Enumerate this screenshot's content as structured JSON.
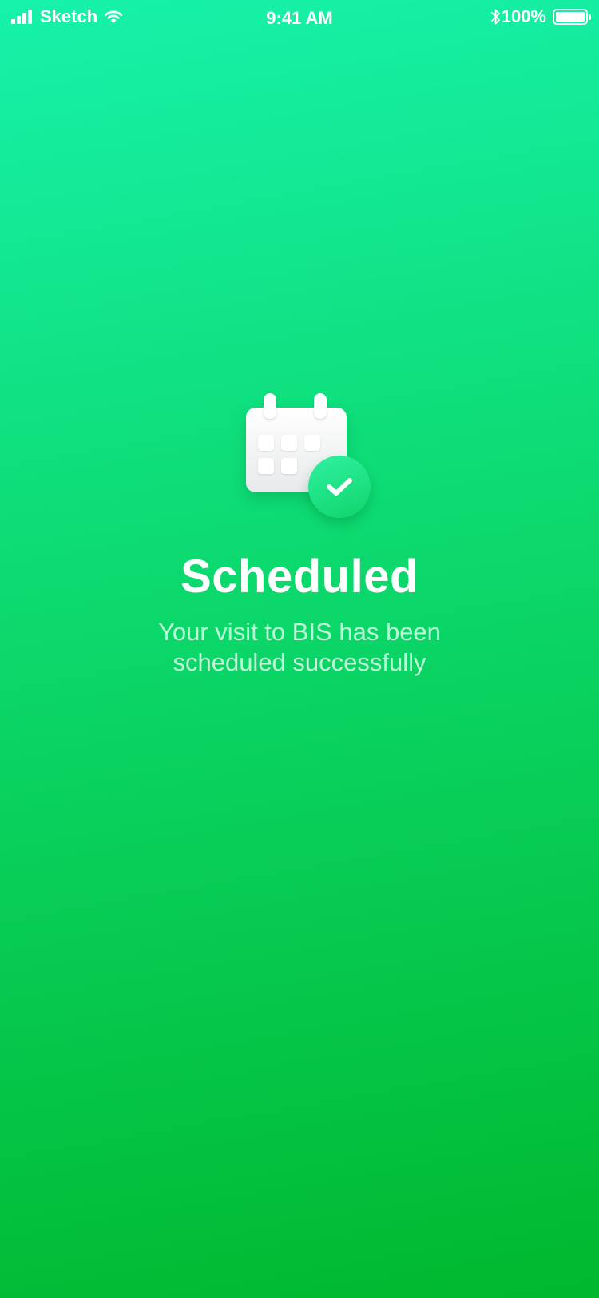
{
  "status_bar": {
    "carrier": "Sketch",
    "time": "9:41 AM",
    "battery_percent_label": "100%",
    "battery_level": 1.0,
    "icons": [
      "signal-bars-icon",
      "wifi-icon",
      "bluetooth-icon",
      "battery-icon"
    ]
  },
  "illustration": {
    "icons": [
      "calendar-icon",
      "check-badge-icon"
    ]
  },
  "confirmation": {
    "title": "Scheduled",
    "message": "Your visit to BIS has been\nscheduled successfully"
  },
  "colors": {
    "gradient_top": "#17f2ab",
    "gradient_bottom": "#00b82e",
    "text_primary": "#ffffff"
  }
}
